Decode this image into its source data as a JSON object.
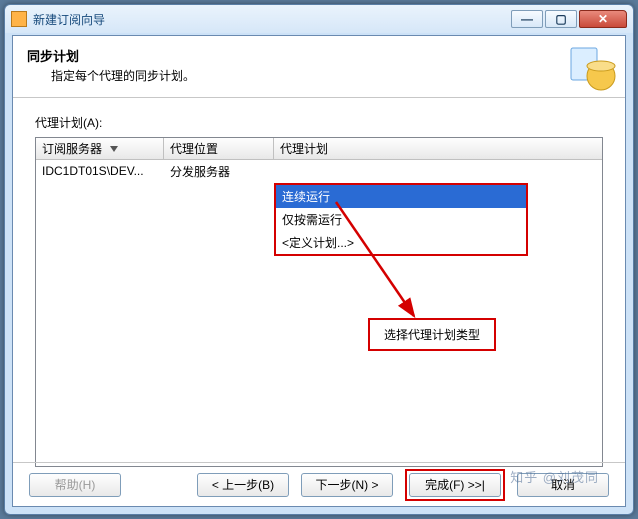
{
  "window": {
    "title": "新建订阅向导"
  },
  "header": {
    "heading": "同步计划",
    "sub": "指定每个代理的同步计划。"
  },
  "grid": {
    "label": "代理计划(A):",
    "columns": {
      "sub": "订阅服务器",
      "loc": "代理位置",
      "plan": "代理计划"
    },
    "row": {
      "sub": "IDC1DT01S\\DEV...",
      "loc": "分发服务器",
      "plan_selected": "连续运行"
    },
    "options": {
      "o1": "连续运行",
      "o2": "仅按需运行",
      "o3": "<定义计划...>"
    }
  },
  "annotation": {
    "callout": "选择代理计划类型"
  },
  "buttons": {
    "help": "帮助(H)",
    "back": "< 上一步(B)",
    "next": "下一步(N) >",
    "finish": "完成(F) >>|",
    "cancel": "取消"
  },
  "watermark": "知乎 @刘茂同"
}
